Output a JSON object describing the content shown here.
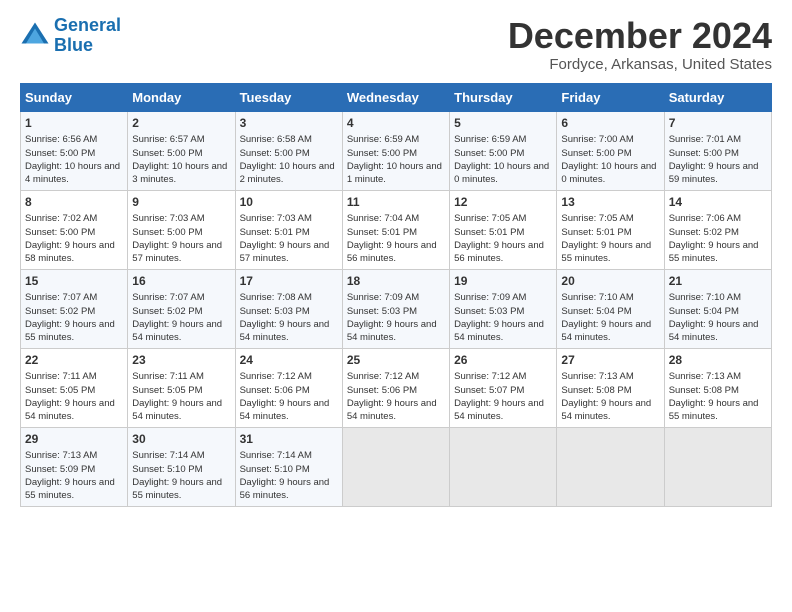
{
  "logo": {
    "line1": "General",
    "line2": "Blue"
  },
  "title": "December 2024",
  "subtitle": "Fordyce, Arkansas, United States",
  "days_of_week": [
    "Sunday",
    "Monday",
    "Tuesday",
    "Wednesday",
    "Thursday",
    "Friday",
    "Saturday"
  ],
  "weeks": [
    [
      {
        "day": "1",
        "sunrise": "6:56 AM",
        "sunset": "5:00 PM",
        "daylight": "10 hours and 4 minutes."
      },
      {
        "day": "2",
        "sunrise": "6:57 AM",
        "sunset": "5:00 PM",
        "daylight": "10 hours and 3 minutes."
      },
      {
        "day": "3",
        "sunrise": "6:58 AM",
        "sunset": "5:00 PM",
        "daylight": "10 hours and 2 minutes."
      },
      {
        "day": "4",
        "sunrise": "6:59 AM",
        "sunset": "5:00 PM",
        "daylight": "10 hours and 1 minute."
      },
      {
        "day": "5",
        "sunrise": "6:59 AM",
        "sunset": "5:00 PM",
        "daylight": "10 hours and 0 minutes."
      },
      {
        "day": "6",
        "sunrise": "7:00 AM",
        "sunset": "5:00 PM",
        "daylight": "10 hours and 0 minutes."
      },
      {
        "day": "7",
        "sunrise": "7:01 AM",
        "sunset": "5:00 PM",
        "daylight": "9 hours and 59 minutes."
      }
    ],
    [
      {
        "day": "8",
        "sunrise": "7:02 AM",
        "sunset": "5:00 PM",
        "daylight": "9 hours and 58 minutes."
      },
      {
        "day": "9",
        "sunrise": "7:03 AM",
        "sunset": "5:00 PM",
        "daylight": "9 hours and 57 minutes."
      },
      {
        "day": "10",
        "sunrise": "7:03 AM",
        "sunset": "5:01 PM",
        "daylight": "9 hours and 57 minutes."
      },
      {
        "day": "11",
        "sunrise": "7:04 AM",
        "sunset": "5:01 PM",
        "daylight": "9 hours and 56 minutes."
      },
      {
        "day": "12",
        "sunrise": "7:05 AM",
        "sunset": "5:01 PM",
        "daylight": "9 hours and 56 minutes."
      },
      {
        "day": "13",
        "sunrise": "7:05 AM",
        "sunset": "5:01 PM",
        "daylight": "9 hours and 55 minutes."
      },
      {
        "day": "14",
        "sunrise": "7:06 AM",
        "sunset": "5:02 PM",
        "daylight": "9 hours and 55 minutes."
      }
    ],
    [
      {
        "day": "15",
        "sunrise": "7:07 AM",
        "sunset": "5:02 PM",
        "daylight": "9 hours and 55 minutes."
      },
      {
        "day": "16",
        "sunrise": "7:07 AM",
        "sunset": "5:02 PM",
        "daylight": "9 hours and 54 minutes."
      },
      {
        "day": "17",
        "sunrise": "7:08 AM",
        "sunset": "5:03 PM",
        "daylight": "9 hours and 54 minutes."
      },
      {
        "day": "18",
        "sunrise": "7:09 AM",
        "sunset": "5:03 PM",
        "daylight": "9 hours and 54 minutes."
      },
      {
        "day": "19",
        "sunrise": "7:09 AM",
        "sunset": "5:03 PM",
        "daylight": "9 hours and 54 minutes."
      },
      {
        "day": "20",
        "sunrise": "7:10 AM",
        "sunset": "5:04 PM",
        "daylight": "9 hours and 54 minutes."
      },
      {
        "day": "21",
        "sunrise": "7:10 AM",
        "sunset": "5:04 PM",
        "daylight": "9 hours and 54 minutes."
      }
    ],
    [
      {
        "day": "22",
        "sunrise": "7:11 AM",
        "sunset": "5:05 PM",
        "daylight": "9 hours and 54 minutes."
      },
      {
        "day": "23",
        "sunrise": "7:11 AM",
        "sunset": "5:05 PM",
        "daylight": "9 hours and 54 minutes."
      },
      {
        "day": "24",
        "sunrise": "7:12 AM",
        "sunset": "5:06 PM",
        "daylight": "9 hours and 54 minutes."
      },
      {
        "day": "25",
        "sunrise": "7:12 AM",
        "sunset": "5:06 PM",
        "daylight": "9 hours and 54 minutes."
      },
      {
        "day": "26",
        "sunrise": "7:12 AM",
        "sunset": "5:07 PM",
        "daylight": "9 hours and 54 minutes."
      },
      {
        "day": "27",
        "sunrise": "7:13 AM",
        "sunset": "5:08 PM",
        "daylight": "9 hours and 54 minutes."
      },
      {
        "day": "28",
        "sunrise": "7:13 AM",
        "sunset": "5:08 PM",
        "daylight": "9 hours and 55 minutes."
      }
    ],
    [
      {
        "day": "29",
        "sunrise": "7:13 AM",
        "sunset": "5:09 PM",
        "daylight": "9 hours and 55 minutes."
      },
      {
        "day": "30",
        "sunrise": "7:14 AM",
        "sunset": "5:10 PM",
        "daylight": "9 hours and 55 minutes."
      },
      {
        "day": "31",
        "sunrise": "7:14 AM",
        "sunset": "5:10 PM",
        "daylight": "9 hours and 56 minutes."
      },
      null,
      null,
      null,
      null
    ]
  ]
}
